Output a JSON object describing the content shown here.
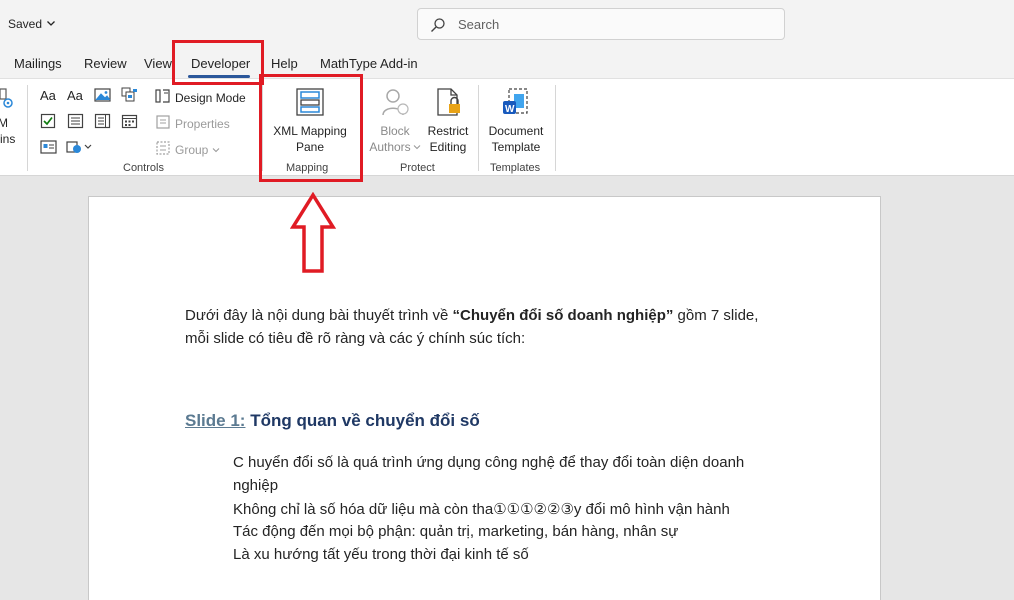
{
  "titlebar": {
    "saved_label": "Saved",
    "search_placeholder": "Search"
  },
  "tabs": [
    {
      "label": "Mailings"
    },
    {
      "label": "Review"
    },
    {
      "label": "View"
    },
    {
      "label": "Developer"
    },
    {
      "label": "Help"
    },
    {
      "label": "MathType Add-in"
    }
  ],
  "ribbon": {
    "addins_partial": {
      "line1": "M",
      "line2": "-ins"
    },
    "controls": {
      "design_mode": "Design Mode",
      "properties": "Properties",
      "group": "Group",
      "label": "Controls"
    },
    "mapping": {
      "xml_line1": "XML Mapping",
      "xml_line2": "Pane",
      "label": "Mapping"
    },
    "protect": {
      "block_line1": "Block",
      "block_line2": "Authors",
      "restrict_line1": "Restrict",
      "restrict_line2": "Editing",
      "label": "Protect"
    },
    "templates": {
      "doc_line1": "Document",
      "doc_line2": "Template",
      "label": "Templates"
    }
  },
  "document": {
    "intro_line1_pre": "Dưới đây là nội dung bài thuyết trình về ",
    "intro_line1_bold": "“Chuyển đổi số doanh nghiệp”",
    "intro_line1_post": " gồm 7 slide,",
    "intro_line2": "mỗi slide có tiêu đề rõ ràng và các ý chính súc tích:",
    "heading_link": "Slide 1:",
    "heading_text": " Tổng quan về chuyển đổi số",
    "bullets": [
      "C huyển đổi số là quá trình ứng dụng công nghệ để thay đổi toàn diện doanh",
      "nghiệp",
      "Không chỉ là số hóa dữ liệu mà còn tha①①①②②③y đổi mô hình vận hành",
      "Tác động đến mọi bộ phận: quản trị, marketing, bán hàng, nhân sự",
      "Là xu hướng tất yếu trong thời đại kinh tế số"
    ]
  },
  "colors": {
    "highlight": "#e01b24",
    "heading": "#1f3864",
    "accent": "#2b579a"
  }
}
